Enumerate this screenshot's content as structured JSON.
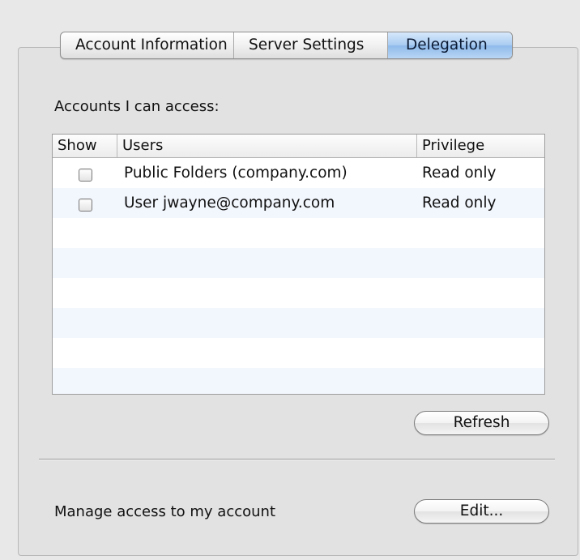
{
  "tabs": {
    "account_information": "Account Information",
    "server_settings": "Server Settings",
    "delegation": "Delegation",
    "selected": "Delegation"
  },
  "accounts_section": {
    "label": "Accounts I can access:",
    "columns": {
      "show": "Show",
      "users": "Users",
      "privilege": "Privilege"
    },
    "rows": [
      {
        "show": false,
        "user": "Public Folders (company.com)",
        "privilege": "Read only"
      },
      {
        "show": false,
        "user": "User jwayne@company.com",
        "privilege": "Read only"
      }
    ],
    "refresh_label": "Refresh"
  },
  "manage_section": {
    "label": "Manage access to my account",
    "edit_label": "Edit..."
  },
  "colors": {
    "selected_tab": "#a9cbf1",
    "alt_row": "#f2f6fd"
  }
}
